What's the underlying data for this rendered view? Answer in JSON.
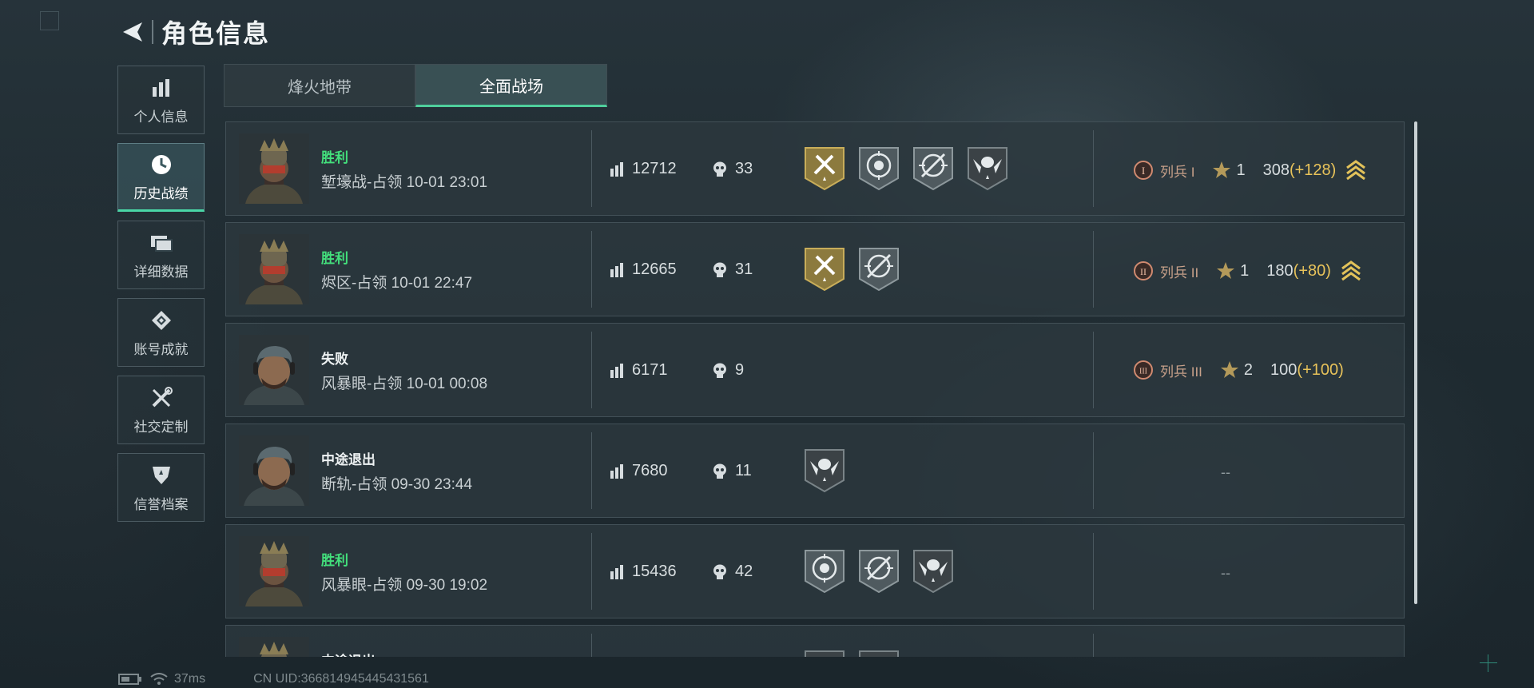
{
  "header": {
    "title": "角色信息"
  },
  "sidebar": {
    "items": [
      {
        "label": "个人信息",
        "icon": "bar-chart-icon"
      },
      {
        "label": "历史战绩",
        "icon": "clock-icon"
      },
      {
        "label": "详细数据",
        "icon": "cards-icon"
      },
      {
        "label": "账号成就",
        "icon": "achievement-icon"
      },
      {
        "label": "社交定制",
        "icon": "tools-icon"
      },
      {
        "label": "信誉档案",
        "icon": "shield-icon"
      }
    ],
    "active_index": 1
  },
  "tabs": [
    {
      "label": "烽火地带"
    },
    {
      "label": "全面战场"
    }
  ],
  "active_tab": 1,
  "matches": [
    {
      "result": "胜利",
      "info": "堑壕战-占领 10-01 23:01",
      "score": "12712",
      "kills": "33",
      "medals": [
        "gold-axes-medal",
        "skull-target-medal",
        "crossed-target-medal",
        "skull-wings-medal"
      ],
      "rank": {
        "numeral": "I",
        "name": "列兵 I",
        "stars": "1",
        "exp": "308",
        "gain": "(+128)"
      }
    },
    {
      "result": "胜利",
      "info": "烬区-占领 10-01 22:47",
      "score": "12665",
      "kills": "31",
      "medals": [
        "gold-axes-medal",
        "crossed-target-medal"
      ],
      "rank": {
        "numeral": "II",
        "name": "列兵 II",
        "stars": "1",
        "exp": "180",
        "gain": "(+80)"
      }
    },
    {
      "result": "失败",
      "info": "风暴眼-占领 10-01 00:08",
      "score": "6171",
      "kills": "9",
      "medals": [],
      "rank": {
        "numeral": "III",
        "name": "列兵 III",
        "stars": "2",
        "exp": "100",
        "gain": "(+100)"
      }
    },
    {
      "result": "中途退出",
      "info": "断轨-占领 09-30 23:44",
      "score": "7680",
      "kills": "11",
      "medals": [
        "skull-wings-medal"
      ],
      "rank": null,
      "rank_placeholder": "--"
    },
    {
      "result": "胜利",
      "info": "风暴眼-占领 09-30 19:02",
      "score": "15436",
      "kills": "42",
      "medals": [
        "skull-target-medal",
        "crossed-target-medal",
        "skull-wings-medal"
      ],
      "rank": null,
      "rank_placeholder": "--"
    },
    {
      "result": "中途退出",
      "info": "",
      "score": "",
      "kills": "",
      "medals": [
        "gold-axes-medal",
        "skull-target-medal"
      ],
      "rank": null,
      "rank_placeholder": ""
    }
  ],
  "footer": {
    "ping": "37ms",
    "uid": "CN UID:3668149454454315​61"
  },
  "colors": {
    "win": "#43e07c",
    "accent": "#4fcf9c",
    "gain": "#e8c35a",
    "rank": "#c8a18a"
  }
}
